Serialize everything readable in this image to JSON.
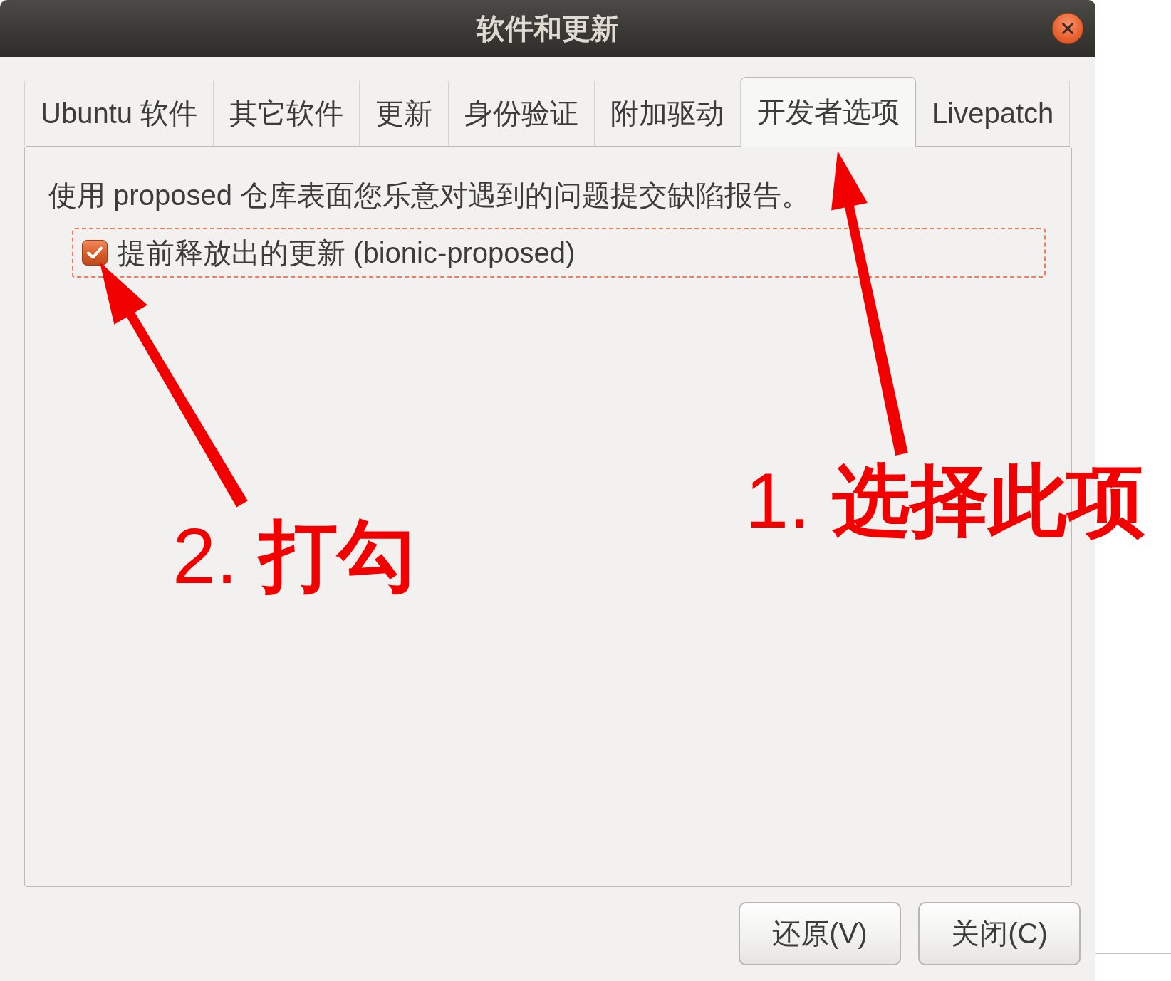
{
  "window": {
    "title": "软件和更新"
  },
  "tabs": [
    {
      "label": "Ubuntu 软件",
      "selected": false
    },
    {
      "label": "其它软件",
      "selected": false
    },
    {
      "label": "更新",
      "selected": false
    },
    {
      "label": "身份验证",
      "selected": false
    },
    {
      "label": "附加驱动",
      "selected": false
    },
    {
      "label": "开发者选项",
      "selected": true
    },
    {
      "label": "Livepatch",
      "selected": false
    }
  ],
  "panel": {
    "description": "使用 proposed 仓库表面您乐意对遇到的问题提交缺陷报告。",
    "options": [
      {
        "label": "提前释放出的更新 (bionic-proposed)",
        "checked": true,
        "focused": true
      }
    ]
  },
  "buttons": [
    {
      "label": "还原(V)"
    },
    {
      "label": "关闭(C)"
    }
  ],
  "annotations": [
    {
      "label": "1. **选择此项**"
    },
    {
      "label": "2. **打勾**"
    }
  ]
}
